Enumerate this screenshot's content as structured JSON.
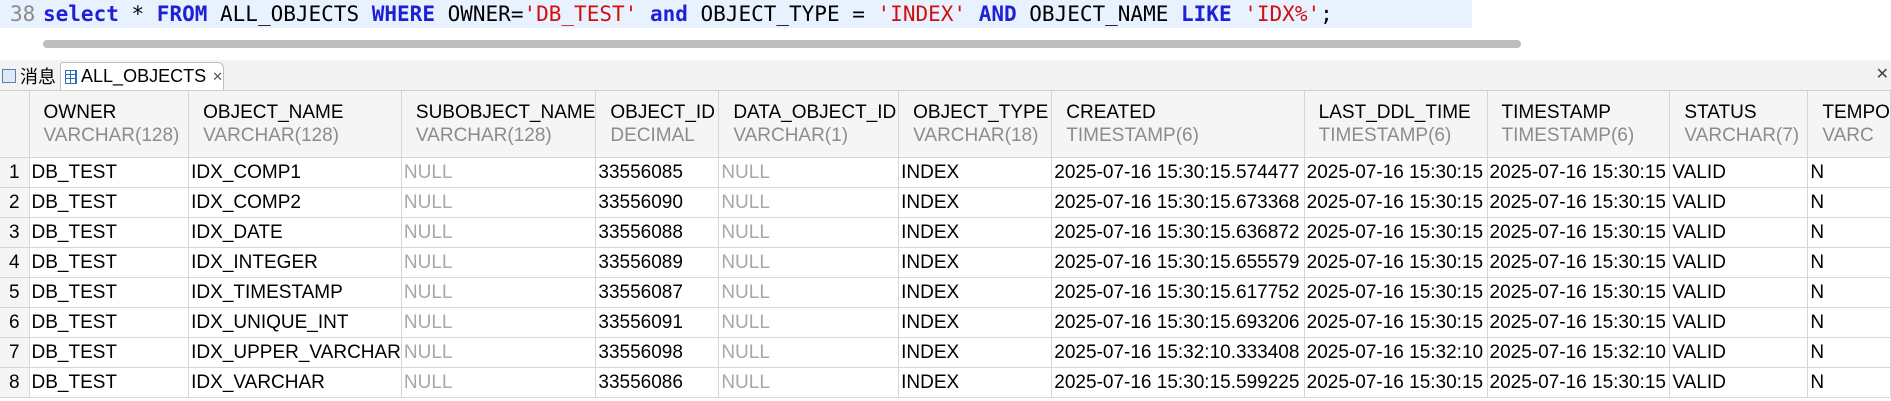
{
  "editor": {
    "line_number": "38",
    "sql": {
      "t1": "select",
      "t2": " * ",
      "t3": "FROM",
      "t4": " ALL_OBJECTS ",
      "t5": "WHERE",
      "t6": " OWNER=",
      "t7": "'DB_TEST'",
      "t8": " ",
      "t9": "and",
      "t10": " OBJECT_TYPE = ",
      "t11": "'INDEX'",
      "t12": " ",
      "t13": "AND",
      "t14": " OBJECT_NAME ",
      "t15": "LIKE",
      "t16": " ",
      "t17": "'IDX%'",
      "t18": ";"
    }
  },
  "tabs": {
    "messages": "消息",
    "result": "ALL_OBJECTS",
    "close_glyph": "✕"
  },
  "columns": [
    {
      "name": "OWNER",
      "type": "VARCHAR(128)"
    },
    {
      "name": "OBJECT_NAME",
      "type": "VARCHAR(128)"
    },
    {
      "name": "SUBOBJECT_NAME",
      "type": "VARCHAR(128)"
    },
    {
      "name": "OBJECT_ID",
      "type": "DECIMAL"
    },
    {
      "name": "DATA_OBJECT_ID",
      "type": "VARCHAR(1)"
    },
    {
      "name": "OBJECT_TYPE",
      "type": "VARCHAR(18)"
    },
    {
      "name": "CREATED",
      "type": "TIMESTAMP(6)"
    },
    {
      "name": "LAST_DDL_TIME",
      "type": "TIMESTAMP(6)"
    },
    {
      "name": "TIMESTAMP",
      "type": "TIMESTAMP(6)"
    },
    {
      "name": "STATUS",
      "type": "VARCHAR(7)"
    },
    {
      "name": "TEMPO",
      "type": "VARC"
    }
  ],
  "rows": [
    {
      "n": "1",
      "owner": "DB_TEST",
      "object_name": "IDX_COMP1",
      "subobject_name": "NULL",
      "object_id": "33556085",
      "data_object_id": "NULL",
      "object_type": "INDEX",
      "created": "2025-07-16 15:30:15.574477",
      "last_ddl_time": "2025-07-16 15:30:15",
      "timestamp": "2025-07-16 15:30:15",
      "status": "VALID",
      "temporary": "N"
    },
    {
      "n": "2",
      "owner": "DB_TEST",
      "object_name": "IDX_COMP2",
      "subobject_name": "NULL",
      "object_id": "33556090",
      "data_object_id": "NULL",
      "object_type": "INDEX",
      "created": "2025-07-16 15:30:15.673368",
      "last_ddl_time": "2025-07-16 15:30:15",
      "timestamp": "2025-07-16 15:30:15",
      "status": "VALID",
      "temporary": "N"
    },
    {
      "n": "3",
      "owner": "DB_TEST",
      "object_name": "IDX_DATE",
      "subobject_name": "NULL",
      "object_id": "33556088",
      "data_object_id": "NULL",
      "object_type": "INDEX",
      "created": "2025-07-16 15:30:15.636872",
      "last_ddl_time": "2025-07-16 15:30:15",
      "timestamp": "2025-07-16 15:30:15",
      "status": "VALID",
      "temporary": "N"
    },
    {
      "n": "4",
      "owner": "DB_TEST",
      "object_name": "IDX_INTEGER",
      "subobject_name": "NULL",
      "object_id": "33556089",
      "data_object_id": "NULL",
      "object_type": "INDEX",
      "created": "2025-07-16 15:30:15.655579",
      "last_ddl_time": "2025-07-16 15:30:15",
      "timestamp": "2025-07-16 15:30:15",
      "status": "VALID",
      "temporary": "N"
    },
    {
      "n": "5",
      "owner": "DB_TEST",
      "object_name": "IDX_TIMESTAMP",
      "subobject_name": "NULL",
      "object_id": "33556087",
      "data_object_id": "NULL",
      "object_type": "INDEX",
      "created": "2025-07-16 15:30:15.617752",
      "last_ddl_time": "2025-07-16 15:30:15",
      "timestamp": "2025-07-16 15:30:15",
      "status": "VALID",
      "temporary": "N"
    },
    {
      "n": "6",
      "owner": "DB_TEST",
      "object_name": "IDX_UNIQUE_INT",
      "subobject_name": "NULL",
      "object_id": "33556091",
      "data_object_id": "NULL",
      "object_type": "INDEX",
      "created": "2025-07-16 15:30:15.693206",
      "last_ddl_time": "2025-07-16 15:30:15",
      "timestamp": "2025-07-16 15:30:15",
      "status": "VALID",
      "temporary": "N"
    },
    {
      "n": "7",
      "owner": "DB_TEST",
      "object_name": "IDX_UPPER_VARCHAR",
      "subobject_name": "NULL",
      "object_id": "33556098",
      "data_object_id": "NULL",
      "object_type": "INDEX",
      "created": "2025-07-16 15:32:10.333408",
      "last_ddl_time": "2025-07-16 15:32:10",
      "timestamp": "2025-07-16 15:32:10",
      "status": "VALID",
      "temporary": "N"
    },
    {
      "n": "8",
      "owner": "DB_TEST",
      "object_name": "IDX_VARCHAR",
      "subobject_name": "NULL",
      "object_id": "33556086",
      "data_object_id": "NULL",
      "object_type": "INDEX",
      "created": "2025-07-16 15:30:15.599225",
      "last_ddl_time": "2025-07-16 15:30:15",
      "timestamp": "2025-07-16 15:30:15",
      "status": "VALID",
      "temporary": "N"
    }
  ]
}
